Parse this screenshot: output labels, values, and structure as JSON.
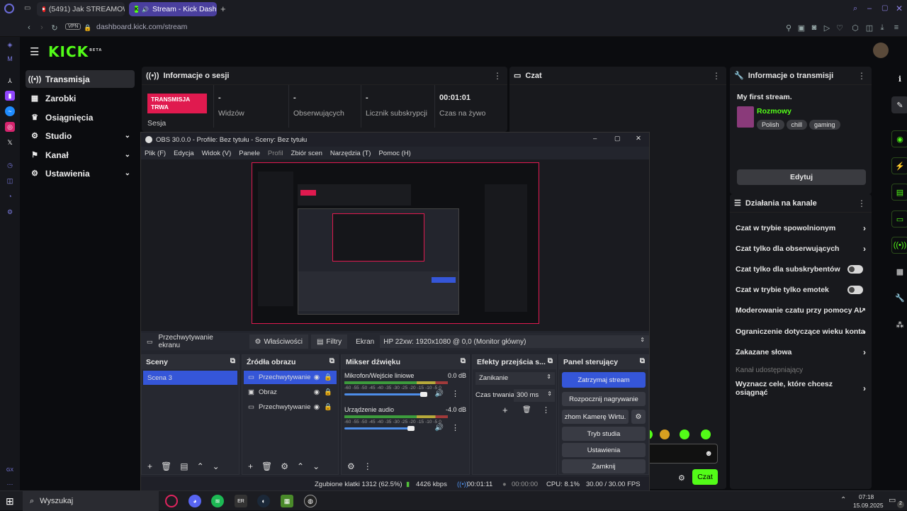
{
  "browser": {
    "tabs": [
      {
        "label": "(5491) Jak STREAMOWAĆ",
        "favicon": "youtube-icon"
      },
      {
        "label": "Stream - Kick Dashbo",
        "favicon": "kick-icon",
        "active": true
      }
    ],
    "vpn_label": "VPN",
    "url": "dashboard.kick.com/stream"
  },
  "kick": {
    "logo": "KICK",
    "logo_badge": "BETA",
    "nav": [
      {
        "label": "Transmisja",
        "icon": "broadcast-icon",
        "active": true
      },
      {
        "label": "Zarobki",
        "icon": "wallet-icon"
      },
      {
        "label": "Osiągnięcia",
        "icon": "trophy-icon"
      },
      {
        "label": "Studio",
        "icon": "gear-icon",
        "expandable": true
      },
      {
        "label": "Kanał",
        "icon": "flag-icon",
        "expandable": true
      },
      {
        "label": "Ustawienia",
        "icon": "settings-icon",
        "expandable": true
      }
    ],
    "session": {
      "title": "Informacje o sesji",
      "status_badge": "TRANSMISJA TRWA",
      "session_label": "Sesja",
      "stats": [
        {
          "value": "-",
          "label": "Widzów"
        },
        {
          "value": "-",
          "label": "Obserwujących"
        },
        {
          "value": "-",
          "label": "Licznik subskrypcji"
        },
        {
          "value": "00:01:01",
          "label": "Czas na żywo"
        }
      ]
    },
    "chat": {
      "title": "Czat",
      "send_label": "Czat"
    },
    "stream_info": {
      "title": "Informacje o transmisji",
      "stream_title": "My first stream.",
      "category": "Rozmowy",
      "tags": [
        "Polish",
        "chill",
        "gaming"
      ],
      "edit_label": "Edytuj"
    },
    "channel_actions": {
      "title": "Działania na kanale",
      "items": [
        {
          "label": "Czat w trybie spowolnionym",
          "control": "chevron"
        },
        {
          "label": "Czat tylko dla obserwujących",
          "control": "chevron"
        },
        {
          "label": "Czat tylko dla subskrybentów",
          "control": "toggle"
        },
        {
          "label": "Czat w trybie tylko emotek",
          "control": "toggle"
        },
        {
          "label": "Moderowanie czatu przy pomocy AI",
          "control": "external"
        },
        {
          "label": "Ograniczenie dotyczące wieku konta",
          "control": "chevron"
        },
        {
          "label": "Zakazane słowa",
          "control": "chevron"
        }
      ],
      "shared_channel": "Kanał udostępniający",
      "goals": "Wyznacz cele, które chcesz osiągnąć"
    }
  },
  "obs": {
    "window_title": "OBS 30.0.0 - Profile: Bez tytułu - Sceny: Bez tytułu",
    "menu": [
      "Plik (F)",
      "Edycja",
      "Widok (V)",
      "Panele",
      "Profil",
      "Zbiór scen",
      "Narzędzia (T)",
      "Pomoc (H)"
    ],
    "source_bar": {
      "source_name": "Przechwytywanie ekranu",
      "properties": "Właściwości",
      "filters": "Filtry",
      "screen_label": "Ekran",
      "screen_value": "HP 22xw: 1920x1080 @ 0,0 (Monitor główny)"
    },
    "scenes": {
      "title": "Sceny",
      "items": [
        "Scena 3"
      ]
    },
    "sources": {
      "title": "Źródła obrazu",
      "items": [
        "Przechwytywanie",
        "Obraz",
        "Przechwytywanie"
      ]
    },
    "mixer": {
      "title": "Mikser dźwięku",
      "channels": [
        {
          "name": "Mikrofon/Wejście liniowe",
          "db": "0.0 dB",
          "level": 0.93
        },
        {
          "name": "Urządzenie audio",
          "db": "-4.0 dB",
          "level": 0.78
        }
      ],
      "scale": [
        "-60",
        "-55",
        "-50",
        "-45",
        "-40",
        "-35",
        "-30",
        "-25",
        "-20",
        "-15",
        "-10",
        "-5",
        "0"
      ]
    },
    "transitions": {
      "title": "Efekty przejścia s...",
      "selected": "Zanikanie",
      "duration_label": "Czas trwania",
      "duration_value": "300 ms"
    },
    "controls": {
      "title": "Panel sterujący",
      "buttons": [
        "Zatrzymaj stream",
        "Rozpocznij nagrywanie",
        "zhom Kamerę Wirtu.",
        "Tryb studia",
        "Ustawienia",
        "Zamknij"
      ]
    },
    "status": {
      "dropped": "Zgubione klatki 1312 (62.5%)",
      "bitrate": "4426 kbps",
      "stream_time": "00:01:11",
      "rec_time": "00:00:00",
      "cpu": "CPU: 8.1%",
      "fps": "30.00 / 30.00 FPS"
    }
  },
  "taskbar": {
    "search_placeholder": "Wyszukaj",
    "time": "07:18",
    "date": "15.09.2025",
    "notification_count": "2"
  },
  "colors": {
    "kick_green": "#53fc18",
    "live_red": "#e01a4f",
    "obs_blue": "#3556d8"
  }
}
